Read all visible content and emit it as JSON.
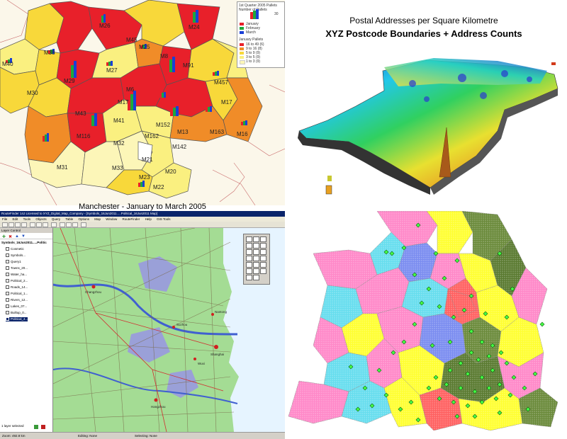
{
  "choropleth": {
    "caption": "Manchester - January to March 2005",
    "legend": {
      "title_lines": [
        "1st Quarter 2005 Pallets",
        "Number of Pallets"
      ],
      "scale_value": "30",
      "series": [
        {
          "name": "January",
          "color": "#e8202a"
        },
        {
          "name": "February",
          "color": "#1ea83a"
        },
        {
          "name": "March",
          "color": "#1a3fd6"
        }
      ],
      "january_title": "January Pallets",
      "classes": [
        {
          "label": "16 to 49   (6)",
          "color": "#e8202a"
        },
        {
          "label": "9 to 16   (8)",
          "color": "#f08c28"
        },
        {
          "label": "5 to 9   (9)",
          "color": "#f8d83a"
        },
        {
          "label": "3 to 5   (9)",
          "color": "#faf080"
        },
        {
          "label": "1 to 3   (9)",
          "color": "#fcf6b8"
        }
      ]
    },
    "district_labels": [
      "M40",
      "M38",
      "M29",
      "M26",
      "M25",
      "M24",
      "M27",
      "M45",
      "M8",
      "M91",
      "M6",
      "M457",
      "M30",
      "M43",
      "M116",
      "M17",
      "M41",
      "M152",
      "M163",
      "M16",
      "M32",
      "M162",
      "M13",
      "M142",
      "M31",
      "M21",
      "M33",
      "M23",
      "M20",
      "M22",
      "M17"
    ]
  },
  "density3d": {
    "title_line1": "Postal Addresses per Square Kilometre",
    "title_line2": "XYZ Postcode Boundaries + Address Counts"
  },
  "gis": {
    "window_title": "RouteFinder 14J Licensed to XYZ_Digital_Map_Company - [Symbols_16Jun2011.....Political_16Jun2011 Map]",
    "menu": [
      "File",
      "Edit",
      "Tools",
      "Objects",
      "Query",
      "Table",
      "Options",
      "Map",
      "Window",
      "RouteFinder",
      "Help",
      "GIS Tools"
    ],
    "layer_panel_title": "Layer Control",
    "layers": [
      "Symbols_16Jun2011.....Politic",
      "Cosmetic",
      "Symbols...",
      "Query1",
      "Towns_20...",
      "Water_ha...",
      "Political_2...",
      "Roads_14...",
      "Political_1...",
      "Rivers_12...",
      "Lakes_07...",
      "Builtup_0...",
      "Political_4..."
    ],
    "layer_status": "1 layer selected",
    "status": {
      "zoom": "Zoom: 492.8 km",
      "editing": "Editing: None",
      "selecting": "Selecting: None"
    },
    "town_labels": [
      "Hangzhou",
      "Shanghai",
      "Suzhou",
      "Wuxi",
      "Changzhou",
      "Nantong"
    ]
  }
}
